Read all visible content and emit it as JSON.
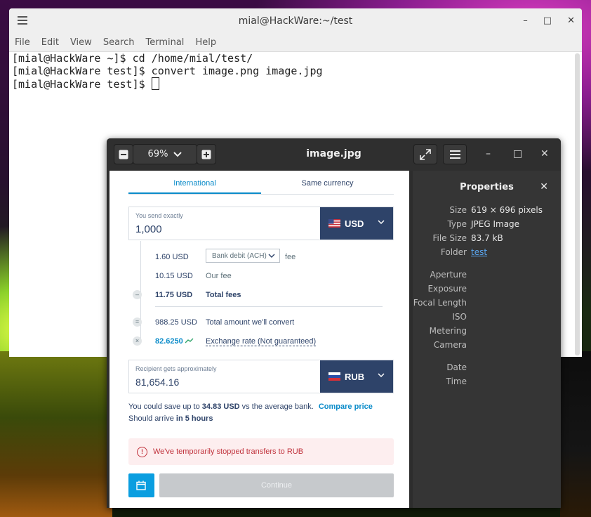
{
  "terminal": {
    "title": "mial@HackWare:~/test",
    "menu": [
      "File",
      "Edit",
      "View",
      "Search",
      "Terminal",
      "Help"
    ],
    "lines": [
      "[mial@HackWare ~]$ cd /home/mial/test/",
      "[mial@HackWare test]$ convert image.png image.jpg",
      "[mial@HackWare test]$ "
    ]
  },
  "viewer": {
    "zoom": "69%",
    "title": "image.jpg",
    "image": {
      "tabs": [
        "International",
        "Same currency"
      ],
      "send_label": "You send exactly",
      "send_value": "1,000",
      "send_currency": "USD",
      "fees": {
        "bank_fee_amount": "1.60 USD",
        "bank_fee_method": "Bank debit (ACH)",
        "bank_fee_suffix": "fee",
        "our_fee_amount": "10.15 USD",
        "our_fee_label": "Our fee",
        "total_amount": "11.75 USD",
        "total_label": "Total fees",
        "convert_amount": "988.25 USD",
        "convert_label": "Total amount we'll convert",
        "rate_value": "82.6250",
        "rate_label": "Exchange rate (Not guaranteed)"
      },
      "receive_label": "Recipient gets approximately",
      "receive_value": "81,654.16",
      "receive_currency": "RUB",
      "save_prefix": "You could save up to",
      "save_amount": "34.83 USD",
      "save_suffix": "vs the average bank.",
      "compare_link": "Compare price",
      "arrive_prefix": "Should arrive",
      "arrive_time": "in 5 hours",
      "alert_text": "We've temporarily stopped transfers to RUB",
      "continue_label": "Continue"
    },
    "properties": {
      "title": "Properties",
      "rows": [
        {
          "key": "Size",
          "value": "619 × 696 pixels"
        },
        {
          "key": "Type",
          "value": "JPEG Image"
        },
        {
          "key": "File Size",
          "value": "83.7 kB"
        },
        {
          "key": "Folder",
          "value": "test"
        },
        {
          "key": "Aperture",
          "value": ""
        },
        {
          "key": "Exposure",
          "value": ""
        },
        {
          "key": "Focal Length",
          "value": ""
        },
        {
          "key": "ISO",
          "value": ""
        },
        {
          "key": "Metering",
          "value": ""
        },
        {
          "key": "Camera",
          "value": ""
        },
        {
          "key": "Date",
          "value": ""
        },
        {
          "key": "Time",
          "value": ""
        }
      ]
    }
  }
}
